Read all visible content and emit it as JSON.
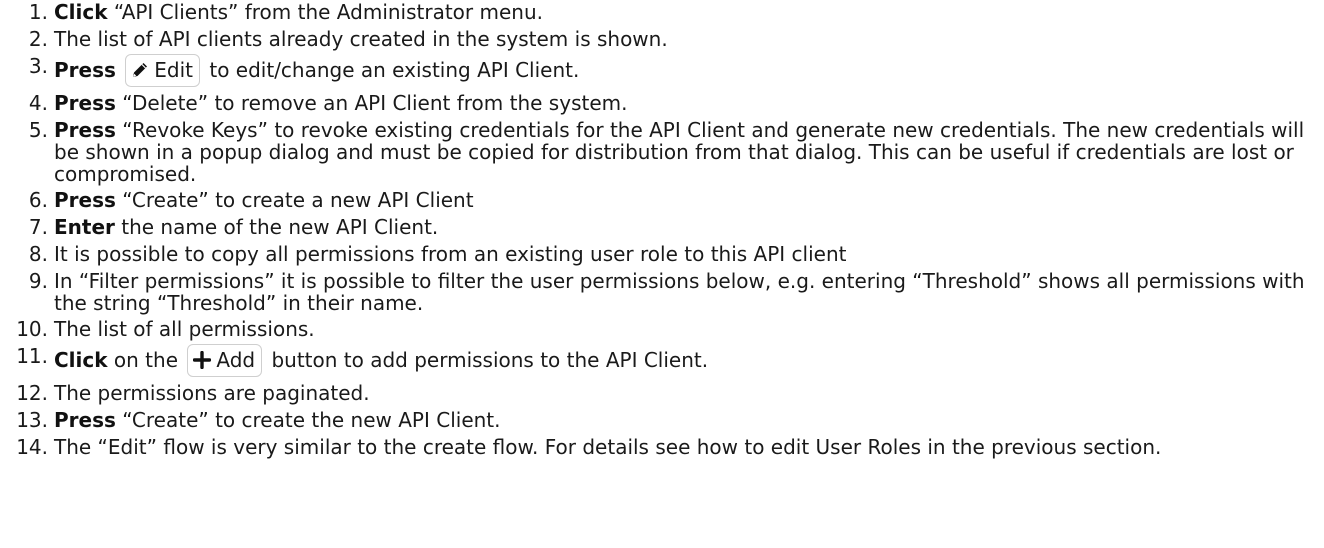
{
  "steps": [
    {
      "num": "1.",
      "bold": "Click",
      "text": " “API Clients” from the Administrator menu."
    },
    {
      "num": "2.",
      "bold": "",
      "text": "The list of API clients already created in the system is shown."
    },
    {
      "num": "3.",
      "bold": "Press",
      "pre": " ",
      "button": "Edit",
      "button_icon": "pencil-icon",
      "text": " to edit/change an existing API Client."
    },
    {
      "num": "4.",
      "bold": "Press",
      "text": " “Delete” to remove an API Client from the system."
    },
    {
      "num": "5.",
      "bold": "Press",
      "text": " “Revoke Keys” to revoke existing credentials for the API Client and generate new credentials. The new credentials will be shown in a popup dialog and must be copied for distribution from that dialog. This can be useful if credentials are lost or compromised."
    },
    {
      "num": "6.",
      "bold": "Press",
      "text": " “Create” to create a new API Client"
    },
    {
      "num": "7.",
      "bold": "Enter",
      "text": " the name of the new API Client."
    },
    {
      "num": "8.",
      "bold": "",
      "text": "It is possible to copy all permissions from an existing user role to this API client"
    },
    {
      "num": "9.",
      "bold": "",
      "text": "In “Filter permissions” it is possible to filter the user permissions below, e.g. entering “Threshold” shows all permissions with the string “Threshold” in their name."
    },
    {
      "num": "10.",
      "bold": "",
      "text": "The list of all permissions."
    },
    {
      "num": "11.",
      "bold": "Click",
      "pre": " on the ",
      "button": "Add",
      "button_icon": "plus-icon",
      "text": " button to add permissions to the API Client."
    },
    {
      "num": "12.",
      "bold": "",
      "text": "The permissions are paginated."
    },
    {
      "num": "13.",
      "bold": "Press",
      "text": " “Create” to create the new API Client."
    },
    {
      "num": "14.",
      "bold": "",
      "text": "The “Edit” flow is very similar to the create flow. For details see how to edit User Roles in the previous section."
    }
  ]
}
